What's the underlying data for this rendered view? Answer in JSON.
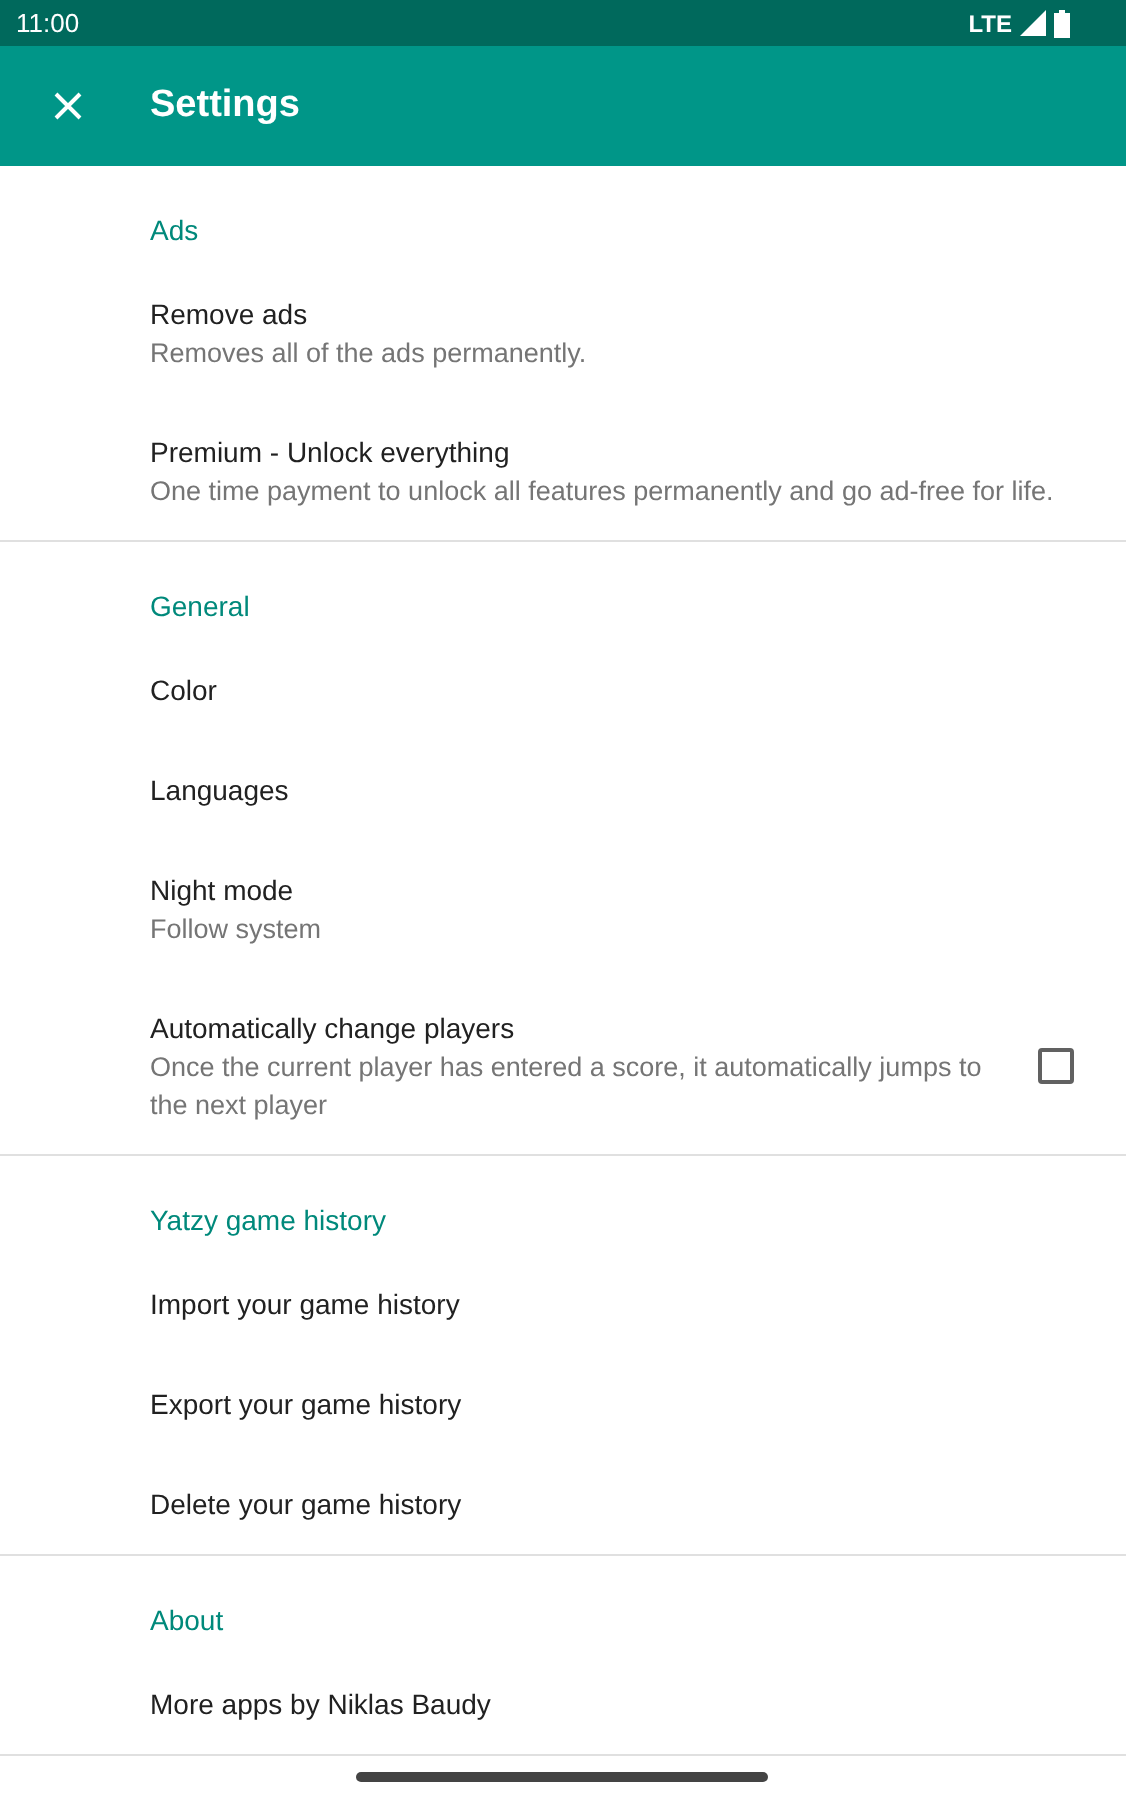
{
  "status_bar": {
    "time": "11:00",
    "network": "LTE"
  },
  "app_bar": {
    "title": "Settings"
  },
  "sections": [
    {
      "title": "Ads",
      "items": [
        {
          "kind": "text",
          "title": "Remove ads",
          "summary": "Removes all of the ads permanently."
        },
        {
          "kind": "text",
          "title": "Premium - Unlock everything",
          "summary": "One time payment to unlock all features permanently and go ad-free for life."
        }
      ]
    },
    {
      "title": "General",
      "items": [
        {
          "kind": "text",
          "title": "Color"
        },
        {
          "kind": "text",
          "title": "Languages"
        },
        {
          "kind": "text",
          "title": "Night mode",
          "summary": "Follow system"
        },
        {
          "kind": "checkbox",
          "title": "Automatically change players",
          "summary": "Once the current player has entered a score, it automatically jumps to the next player",
          "checked": false
        }
      ]
    },
    {
      "title": "Yatzy game history",
      "items": [
        {
          "kind": "text",
          "title": "Import your game history"
        },
        {
          "kind": "text",
          "title": "Export your game history"
        },
        {
          "kind": "text",
          "title": "Delete your game history"
        }
      ]
    },
    {
      "title": "About",
      "items": [
        {
          "kind": "text",
          "title": "More apps by Niklas Baudy"
        }
      ]
    }
  ]
}
